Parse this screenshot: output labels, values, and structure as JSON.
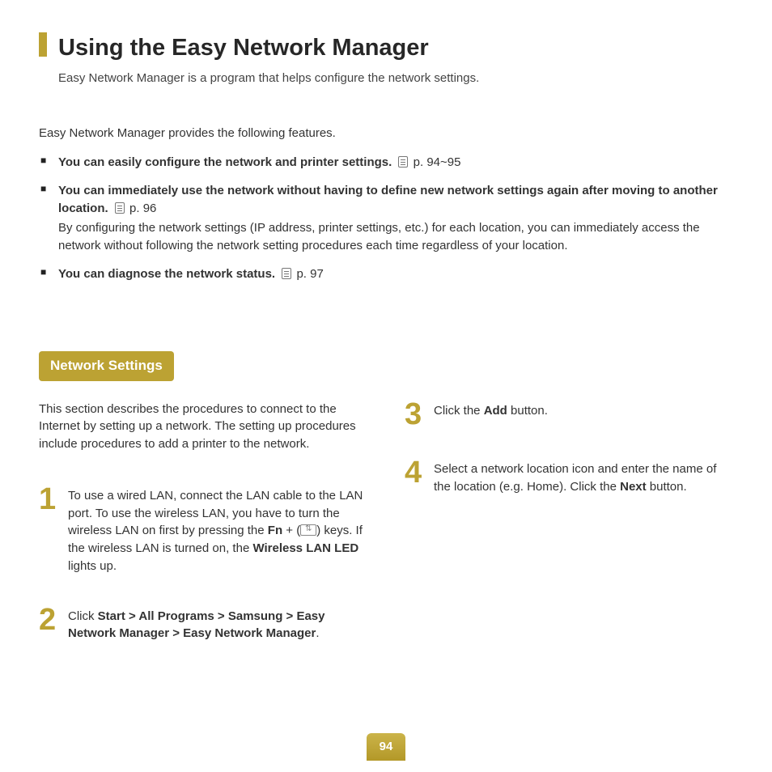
{
  "title": "Using the Easy Network Manager",
  "subtitle": "Easy Network Manager is a program that helps configure the network settings.",
  "intro": "Easy Network Manager provides the following features.",
  "features": [
    {
      "bold": "You can easily configure the network and printer settings.",
      "ref": "p. 94~95",
      "note": null
    },
    {
      "bold": "You can immediately use the network without having to define new network settings again after moving to another location.",
      "ref": "p. 96",
      "note": "By configuring the network settings (IP address, printer settings, etc.) for each location, you can immediately access the network without following the network setting procedures each time regardless of your location."
    },
    {
      "bold": "You can diagnose the network status.",
      "ref": "p. 97",
      "note": null
    }
  ],
  "section": "Network Settings",
  "section_intro": "This section describes the procedures to connect to the Internet by setting up a network. The setting up procedures include procedures to add a printer to the network.",
  "steps_left": [
    {
      "num": "1",
      "pre": "To use a wired LAN, connect the LAN cable to the LAN port. To use the wireless LAN, you have to turn the wireless LAN on first by pressing the  ",
      "key1": "Fn",
      "mid": " + (",
      "post": ") keys. If the wireless LAN is turned on, the ",
      "key2": "Wireless LAN LED",
      "tail": " lights up."
    },
    {
      "num": "2",
      "pre": "Click ",
      "key1": "Start > All Programs > Samsung > Easy Network Manager > Easy Network Manager",
      "mid": "",
      "post": ".",
      "key2": "",
      "tail": ""
    }
  ],
  "steps_right": [
    {
      "num": "3",
      "pre": "Click the ",
      "key1": "Add",
      "post": " button."
    },
    {
      "num": "4",
      "pre": "Select a network location icon and enter the name of the location (e.g. Home). Click the ",
      "key1": "Next",
      "post": " button."
    }
  ],
  "page_number": "94"
}
